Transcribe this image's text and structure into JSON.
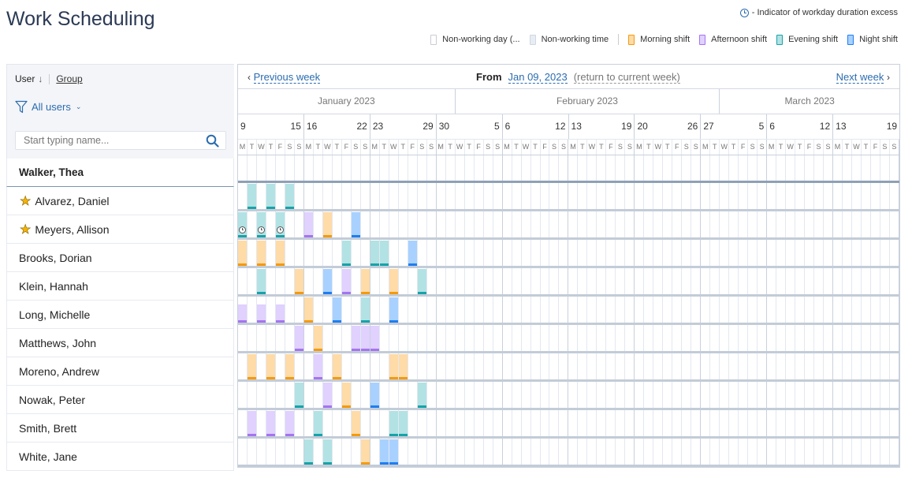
{
  "header": {
    "title": "Work Scheduling",
    "excess_indicator": "- Indicator of workday duration excess"
  },
  "legend": [
    {
      "key": "nonworking_day",
      "label": "Non-working day (...",
      "fill": "#ffffff",
      "border": "#c8ccd2"
    },
    {
      "key": "nonworking_time",
      "label": "Non-working time",
      "fill": "#e8edf3",
      "border": "#d0d7e0"
    },
    {
      "key": "morning",
      "label": "Morning shift",
      "fill": "#ffdba8",
      "border": "#f59a0b"
    },
    {
      "key": "afternoon",
      "label": "Afternoon shift",
      "fill": "#e0d1ff",
      "border": "#a574f0"
    },
    {
      "key": "evening",
      "label": "Evening shift",
      "fill": "#b2e2e4",
      "border": "#17a3a8"
    },
    {
      "key": "night",
      "label": "Night shift",
      "fill": "#a8d1ff",
      "border": "#1e7ef0"
    }
  ],
  "sidebar": {
    "sort_label": "User",
    "sort_arrow": "↓",
    "group_label": "Group",
    "filter_label": "All users",
    "search_placeholder": "Start typing name..."
  },
  "nav": {
    "prev_label": "Previous week",
    "next_label": "Next week",
    "from_label": "From",
    "from_date": "Jan 09, 2023",
    "return_label": "(return to current week)"
  },
  "months": [
    {
      "label": "January 2023",
      "days": 23
    },
    {
      "label": "February 2023",
      "days": 28
    },
    {
      "label": "March 2023",
      "days": 19
    }
  ],
  "weeks": [
    {
      "start": "9",
      "end": "15"
    },
    {
      "start": "16",
      "end": "22"
    },
    {
      "start": "23",
      "end": "29"
    },
    {
      "start": "30",
      "end": "5"
    },
    {
      "start": "6",
      "end": "12"
    },
    {
      "start": "13",
      "end": "19"
    },
    {
      "start": "20",
      "end": "26"
    },
    {
      "start": "27",
      "end": "5"
    },
    {
      "start": "6",
      "end": "12"
    },
    {
      "start": "13",
      "end": "19"
    }
  ],
  "weekday_letters": [
    "M",
    "T",
    "W",
    "T",
    "F",
    "S",
    "S"
  ],
  "users": [
    {
      "name": "Walker, Thea",
      "starred": false,
      "current": true,
      "shifts": []
    },
    {
      "name": "Alvarez, Daniel",
      "starred": true,
      "shifts": [
        {
          "day": 1,
          "type": "evening"
        },
        {
          "day": 3,
          "type": "evening"
        },
        {
          "day": 5,
          "type": "evening"
        }
      ]
    },
    {
      "name": "Meyers, Allison",
      "starred": true,
      "shifts": [
        {
          "day": 0,
          "type": "evening",
          "excess": true
        },
        {
          "day": 2,
          "type": "evening",
          "excess": true
        },
        {
          "day": 4,
          "type": "evening",
          "excess": true
        },
        {
          "day": 7,
          "type": "afternoon"
        },
        {
          "day": 9,
          "type": "morning"
        },
        {
          "day": 12,
          "type": "night"
        }
      ]
    },
    {
      "name": "Brooks, Dorian",
      "starred": false,
      "shifts": [
        {
          "day": 0,
          "type": "morning"
        },
        {
          "day": 2,
          "type": "morning"
        },
        {
          "day": 4,
          "type": "morning"
        },
        {
          "day": 11,
          "type": "evening"
        },
        {
          "day": 14,
          "type": "evening"
        },
        {
          "day": 15,
          "type": "evening"
        },
        {
          "day": 18,
          "type": "night"
        }
      ]
    },
    {
      "name": "Klein, Hannah",
      "starred": false,
      "shifts": [
        {
          "day": 2,
          "type": "evening"
        },
        {
          "day": 6,
          "type": "morning"
        },
        {
          "day": 9,
          "type": "night"
        },
        {
          "day": 11,
          "type": "afternoon"
        },
        {
          "day": 13,
          "type": "morning"
        },
        {
          "day": 16,
          "type": "morning"
        },
        {
          "day": 19,
          "type": "evening"
        }
      ]
    },
    {
      "name": "Long, Michelle",
      "starred": false,
      "shifts": [
        {
          "day": 0,
          "type": "afternoon",
          "partial": true
        },
        {
          "day": 2,
          "type": "afternoon",
          "partial": true
        },
        {
          "day": 4,
          "type": "afternoon",
          "partial": true
        },
        {
          "day": 7,
          "type": "morning"
        },
        {
          "day": 10,
          "type": "night"
        },
        {
          "day": 13,
          "type": "evening"
        },
        {
          "day": 16,
          "type": "night"
        }
      ]
    },
    {
      "name": "Matthews, John",
      "starred": false,
      "shifts": [
        {
          "day": 6,
          "type": "afternoon"
        },
        {
          "day": 8,
          "type": "morning"
        },
        {
          "day": 12,
          "type": "afternoon"
        },
        {
          "day": 13,
          "type": "afternoon"
        },
        {
          "day": 14,
          "type": "afternoon"
        }
      ]
    },
    {
      "name": "Moreno, Andrew",
      "starred": false,
      "shifts": [
        {
          "day": 1,
          "type": "morning"
        },
        {
          "day": 3,
          "type": "morning"
        },
        {
          "day": 5,
          "type": "morning"
        },
        {
          "day": 8,
          "type": "afternoon"
        },
        {
          "day": 10,
          "type": "morning"
        },
        {
          "day": 16,
          "type": "morning"
        },
        {
          "day": 17,
          "type": "morning"
        }
      ]
    },
    {
      "name": "Nowak, Peter",
      "starred": false,
      "shifts": [
        {
          "day": 6,
          "type": "evening"
        },
        {
          "day": 9,
          "type": "afternoon"
        },
        {
          "day": 11,
          "type": "morning"
        },
        {
          "day": 14,
          "type": "night"
        },
        {
          "day": 19,
          "type": "evening"
        }
      ]
    },
    {
      "name": "Smith, Brett",
      "starred": false,
      "shifts": [
        {
          "day": 1,
          "type": "afternoon"
        },
        {
          "day": 3,
          "type": "afternoon"
        },
        {
          "day": 5,
          "type": "afternoon"
        },
        {
          "day": 8,
          "type": "evening"
        },
        {
          "day": 12,
          "type": "morning"
        },
        {
          "day": 16,
          "type": "evening"
        },
        {
          "day": 17,
          "type": "evening"
        }
      ]
    },
    {
      "name": "White, Jane",
      "starred": false,
      "shifts": [
        {
          "day": 7,
          "type": "evening"
        },
        {
          "day": 9,
          "type": "evening"
        },
        {
          "day": 13,
          "type": "morning"
        },
        {
          "day": 15,
          "type": "night"
        },
        {
          "day": 16,
          "type": "night"
        }
      ]
    }
  ]
}
